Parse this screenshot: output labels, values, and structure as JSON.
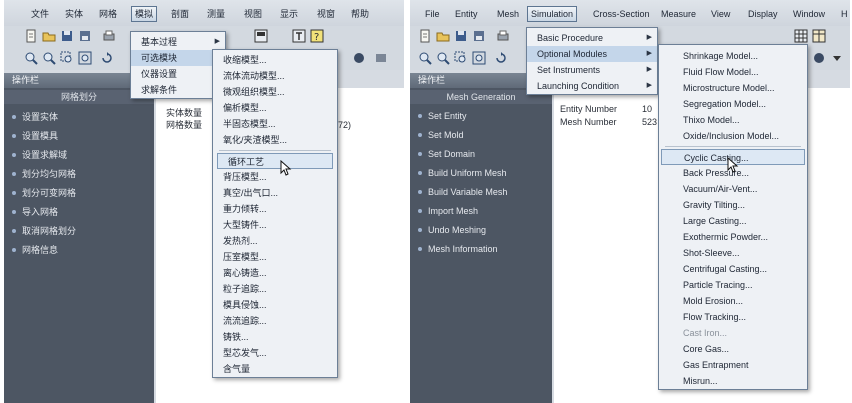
{
  "colors": {
    "accent": "#c4d6ea",
    "sidebar": "#4d5663",
    "menubar": "#cfd5dd",
    "menu_bg": "#eef1f5"
  },
  "left": {
    "menubar": [
      "文件",
      "实体",
      "网格",
      "模拟",
      "剖面",
      "测量",
      "视图",
      "显示",
      "视窗",
      "帮助"
    ],
    "active_menu_index": 3,
    "sidebar": {
      "title": "操作栏",
      "header": "网格划分",
      "items": [
        "设置实体",
        "设置模具",
        "设置求解域",
        "划分均匀网格",
        "划分可变网格",
        "导入网格",
        "取消网格划分",
        "网格信息"
      ]
    },
    "info": {
      "entity_label": "实体数量",
      "mesh_label": "网格数量",
      "mesh_value_fragment": "72)"
    },
    "sim_menu": [
      {
        "label": "基本过程",
        "arrow": "▶"
      },
      {
        "label": "可选模块",
        "arrow": "▶"
      },
      {
        "label": "仪器设置",
        "arrow": "▶"
      },
      {
        "label": "求解条件",
        "arrow": "▶"
      }
    ],
    "modules_menu": [
      "收缩模型...",
      "流体流动模型...",
      "微观组织模型...",
      "偏析模型...",
      "半固态模型...",
      "氧化/夹渣模型...",
      "循环工艺",
      "背压模型...",
      "真空/出气口...",
      "重力倾转...",
      "大型铸件...",
      "发热剂...",
      "压室模型...",
      "离心铸造...",
      "粒子追踪...",
      "模具侵蚀...",
      "流流追踪...",
      "铸铁...",
      "型芯发气...",
      "含气量"
    ]
  },
  "right": {
    "menubar": [
      "File",
      "Entity",
      "Mesh",
      "Simulation",
      "Cross-Section",
      "Measure",
      "View",
      "Display",
      "Window",
      "H"
    ],
    "active_menu_index": 3,
    "sidebar": {
      "title": "操作栏",
      "header": "Mesh Generation",
      "items": [
        "Set Entity",
        "Set Mold",
        "Set Domain",
        "Build Uniform Mesh",
        "Build Variable Mesh",
        "Import Mesh",
        "Undo Meshing",
        "Mesh Information"
      ]
    },
    "info": {
      "entity_label": "Entity Number",
      "entity_value": "10",
      "mesh_label": "Mesh Number",
      "mesh_value": "523"
    },
    "sim_menu": [
      {
        "label": "Basic Procedure",
        "arrow": "▶"
      },
      {
        "label": "Optional Modules",
        "arrow": "▶"
      },
      {
        "label": "Set Instruments",
        "arrow": "▶"
      },
      {
        "label": "Launching Condition",
        "arrow": "▶"
      }
    ],
    "modules_menu": [
      "Shrinkage Model...",
      "Fluid Flow Model...",
      "Microstructure Model...",
      "Segregation Model...",
      "Thixo Model...",
      "Oxide/Inclusion Model...",
      "Cyclic Casting...",
      "Back Pressure...",
      "Vacuum/Air-Vent...",
      "Gravity Tilting...",
      "Large Casting...",
      "Exothermic Powder...",
      "Shot-Sleeve...",
      "Centrifugal Casting...",
      "Particle Tracing...",
      "Mold Erosion...",
      "Flow Tracking...",
      "Cast Iron...",
      "Core Gas...",
      "Gas Entrapment",
      "Misrun..."
    ]
  }
}
